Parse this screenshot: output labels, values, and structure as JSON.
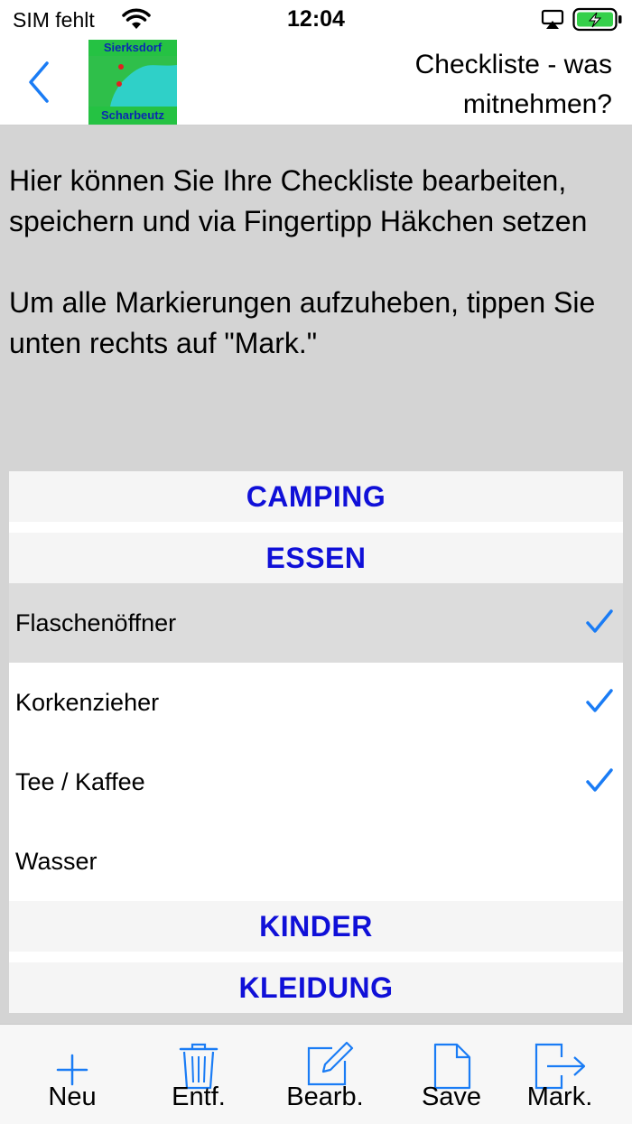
{
  "status_bar": {
    "carrier": "SIM fehlt",
    "time": "12:04"
  },
  "nav": {
    "logo_top": "Sierksdorf",
    "logo_bottom": "Scharbeutz",
    "title": "Checkliste - was mitnehmen?"
  },
  "intro": {
    "paragraph1": "Hier können Sie Ihre Checkliste bearbeiten, speichern und via Fingertipp Häkchen setzen",
    "paragraph2": "Um alle Markierungen aufzuheben, tippen Sie unten rechts auf \"Mark.\""
  },
  "list": {
    "sections": [
      {
        "title": "CAMPING",
        "items": []
      },
      {
        "title": "ESSEN",
        "items": [
          {
            "label": "Flaschenöffner",
            "checked": true,
            "highlighted": true
          },
          {
            "label": "Korkenzieher",
            "checked": true,
            "highlighted": false
          },
          {
            "label": "Tee / Kaffee",
            "checked": true,
            "highlighted": false
          },
          {
            "label": "Wasser",
            "checked": false,
            "highlighted": false
          }
        ]
      },
      {
        "title": "KINDER",
        "items": []
      },
      {
        "title": "KLEIDUNG",
        "items": []
      }
    ]
  },
  "toolbar": {
    "new_label": "Neu",
    "delete_label": "Entf.",
    "edit_label": "Bearb.",
    "save_label": "Save",
    "mark_label": "Mark."
  },
  "colors": {
    "accent": "#1a7cf5",
    "section_text": "#1010d8",
    "background": "#d4d4d4"
  }
}
